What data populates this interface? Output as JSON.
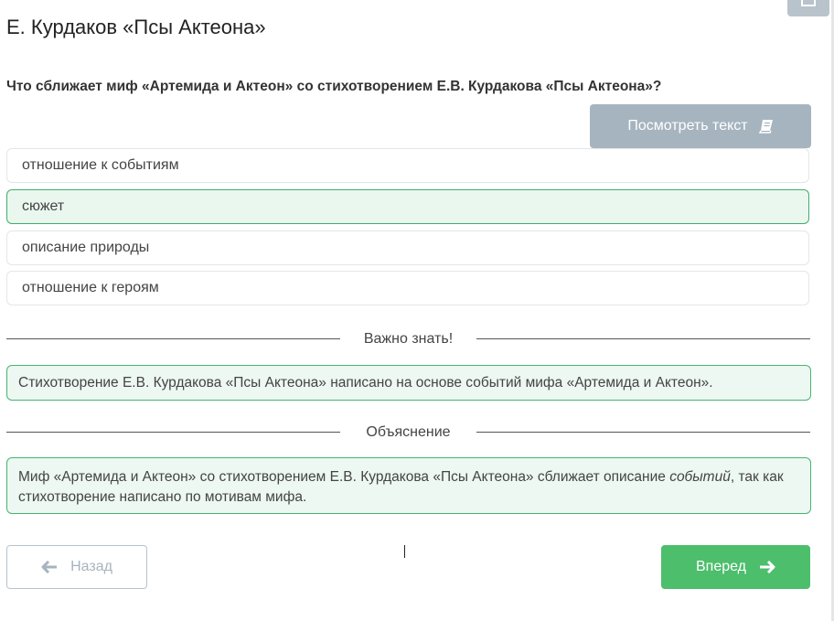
{
  "page": {
    "title": "Е. Курдаков «Псы Актеона»"
  },
  "question": {
    "text": "Что сближает миф «Артемида и Актеон» со стихотворением Е.В. Курдакова «Псы Актеона»?"
  },
  "view_text_button": {
    "label": "Посмотреть текст",
    "icon": "book-icon"
  },
  "options": [
    {
      "label": "отношение к событиям",
      "selected": false
    },
    {
      "label": "сюжет",
      "selected": true
    },
    {
      "label": "описание природы",
      "selected": false
    },
    {
      "label": "отношение к героям",
      "selected": false
    }
  ],
  "important": {
    "heading": "Важно знать!",
    "text": "Стихотворение Е.В. Курдакова «Псы Актеона» написано на основе событий мифа «Артемида и Актеон»."
  },
  "explanation": {
    "heading": "Объяснение",
    "text_before": "Миф «Артемида и Актеон» со стихотворением Е.В. Курдакова «Псы Актеона» сближает описание ",
    "text_emphasis": "событий",
    "text_after": ", так как стихотворение написано по мотивам мифа."
  },
  "navigation": {
    "back_label": "Назад",
    "back_icon": "arrow-left-icon",
    "next_label": "Вперед",
    "next_icon": "arrow-right-icon"
  },
  "colors": {
    "accent_green": "#4cbe6c",
    "selected_border": "#3fae6b",
    "selected_bg": "#eaf7ef",
    "muted_button": "#a6b4bf"
  }
}
